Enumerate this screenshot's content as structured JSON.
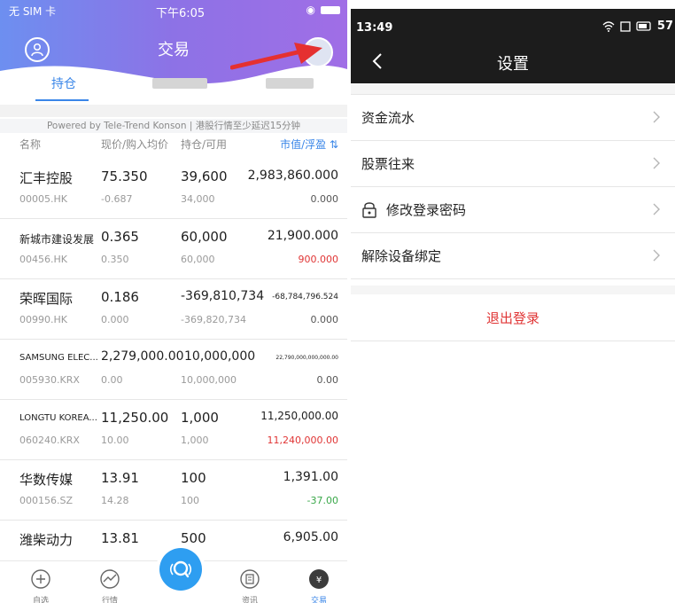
{
  "left_screen": {
    "status_bar": {
      "carrier": "无 SIM 卡",
      "time": "下午6:05"
    },
    "title": "交易",
    "tabs": [
      {
        "label": "持仓",
        "active": true
      }
    ],
    "powered_by": "Powered by Tele-Trend Konson | 港股行情至少延迟15分钟",
    "columns": [
      "名称",
      "现价/购入均价",
      "持仓/可用",
      "市值/浮盈"
    ],
    "holdings": [
      {
        "name": "汇丰控股",
        "code": "00005.HK",
        "price": "75.350",
        "avg_cost": "-0.687",
        "holding": "39,600",
        "available": "34,000",
        "market_value": "2,983,860.000",
        "pnl": "0.000",
        "pnl_trend": "zero"
      },
      {
        "name": "新城市建设发展",
        "code": "00456.HK",
        "price": "0.365",
        "avg_cost": "0.350",
        "holding": "60,000",
        "available": "60,000",
        "market_value": "21,900.000",
        "pnl": "900.000",
        "pnl_trend": "up"
      },
      {
        "name": "荣晖国际",
        "code": "00990.HK",
        "price": "0.186",
        "avg_cost": "0.000",
        "holding": "-369,810,734",
        "available": "-369,820,734",
        "market_value": "-68,784,796.524",
        "pnl": "0.000",
        "pnl_trend": "zero"
      },
      {
        "name": "SAMSUNG ELEC...",
        "code": "005930.KRX",
        "price": "2,279,000.00",
        "avg_cost": "0.00",
        "holding": "10,000,000",
        "available": "10,000,000",
        "market_value": "22,790,000,000,000.00",
        "pnl": "0.00",
        "pnl_trend": "zero"
      },
      {
        "name": "LONGTU KOREA...",
        "code": "060240.KRX",
        "price": "11,250.00",
        "avg_cost": "10.00",
        "holding": "1,000",
        "available": "1,000",
        "market_value": "11,250,000.00",
        "pnl": "11,240,000.00",
        "pnl_trend": "up"
      },
      {
        "name": "华数传媒",
        "code": "000156.SZ",
        "price": "13.91",
        "avg_cost": "14.28",
        "holding": "100",
        "available": "100",
        "market_value": "1,391.00",
        "pnl": "-37.00",
        "pnl_trend": "down"
      },
      {
        "name": "潍柴动力",
        "code": "",
        "price": "13.81",
        "avg_cost": "",
        "holding": "500",
        "available": "",
        "market_value": "6,905.00",
        "pnl": "",
        "pnl_trend": "up"
      }
    ],
    "bottom_nav": [
      {
        "label": "自选",
        "icon": "plus-circle-icon"
      },
      {
        "label": "行情",
        "icon": "trend-line-icon"
      },
      {
        "label": "",
        "icon": "search-fab-icon"
      },
      {
        "label": "资讯",
        "icon": "news-icon"
      },
      {
        "label": "交易",
        "icon": "trade-icon",
        "active": true
      }
    ]
  },
  "right_screen": {
    "status_bar": {
      "time": "13:49",
      "battery": "57"
    },
    "title": "设置",
    "menu": [
      {
        "label": "资金流水"
      },
      {
        "label": "股票往来"
      },
      {
        "label": "修改登录密码",
        "icon": "lock-icon"
      },
      {
        "label": "解除设备绑定"
      }
    ],
    "logout": "退出登录"
  },
  "colors": {
    "accent_blue": "#3a86e8",
    "up_red": "#e03535",
    "down_green": "#3aa84a",
    "header_purple": "#7a6ee0",
    "fab_blue": "#2e9ef1"
  }
}
